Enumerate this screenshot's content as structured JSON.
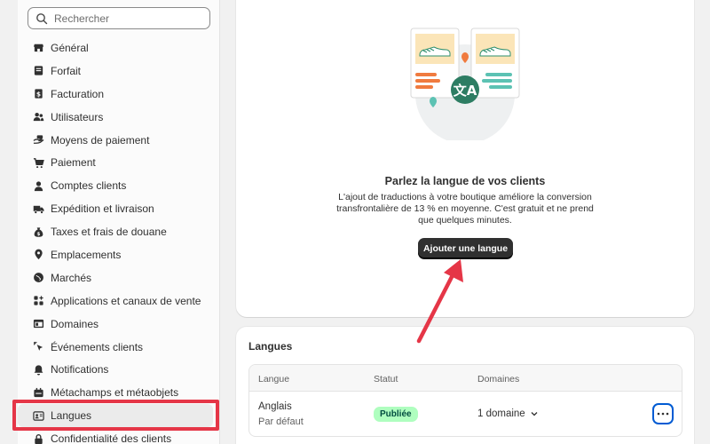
{
  "search": {
    "placeholder": "Rechercher",
    "icon": "search-icon"
  },
  "sidebar": {
    "items": [
      {
        "label": "Général",
        "icon": "store-icon"
      },
      {
        "label": "Forfait",
        "icon": "plan-icon"
      },
      {
        "label": "Facturation",
        "icon": "billing-icon"
      },
      {
        "label": "Utilisateurs",
        "icon": "users-icon"
      },
      {
        "label": "Moyens de paiement",
        "icon": "payment-hand-icon"
      },
      {
        "label": "Paiement",
        "icon": "cart-icon"
      },
      {
        "label": "Comptes clients",
        "icon": "person-icon"
      },
      {
        "label": "Expédition et livraison",
        "icon": "truck-icon"
      },
      {
        "label": "Taxes et frais de douane",
        "icon": "money-bag-icon"
      },
      {
        "label": "Emplacements",
        "icon": "location-icon"
      },
      {
        "label": "Marchés",
        "icon": "globe-icon"
      },
      {
        "label": "Applications et canaux de vente",
        "icon": "apps-icon"
      },
      {
        "label": "Domaines",
        "icon": "domain-icon"
      },
      {
        "label": "Événements clients",
        "icon": "cursor-icon"
      },
      {
        "label": "Notifications",
        "icon": "bell-icon"
      },
      {
        "label": "Métachamps et métaobjets",
        "icon": "metafield-icon"
      },
      {
        "label": "Langues",
        "icon": "language-icon",
        "active": true
      },
      {
        "label": "Confidentialité des clients",
        "icon": "lock-icon"
      }
    ]
  },
  "empty_state": {
    "title": "Parlez la langue de vos clients",
    "description": "L'ajout de traductions à votre boutique améliore la conversion transfrontalière de 13 % en moyenne. C'est gratuit et ne prend que quelques minutes.",
    "button_label": "Ajouter une langue"
  },
  "languages": {
    "title": "Langues",
    "columns": [
      "Langue",
      "Statut",
      "Domaines"
    ],
    "rows": [
      {
        "name": "Anglais",
        "sub": "Par défaut",
        "status": "Publiée",
        "domains": "1 domaine"
      }
    ]
  },
  "colors": {
    "accent_red": "#e53647",
    "badge_green_bg": "#affebf",
    "primary_button": "#303030",
    "focus_blue": "#005bd3"
  }
}
